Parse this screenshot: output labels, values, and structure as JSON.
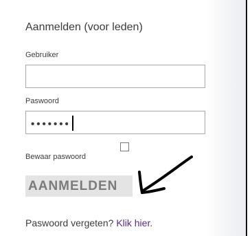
{
  "login": {
    "heading": "Aanmelden (voor leden)",
    "username_label": "Gebruiker",
    "username_value": "",
    "password_label": "Paswoord",
    "password_masked": "•••••••",
    "remember_label": "Bewaar paswoord",
    "remember_checked": false,
    "submit_label": "AANMELDEN",
    "forgot_text": "Paswoord vergeten? ",
    "forgot_link": "Klik hier."
  },
  "colors": {
    "text": "#3c3c3c",
    "link": "#5b2a86",
    "button_bg": "#e4e4e4",
    "button_text": "#7b7b7b",
    "field_border": "#a8a8a8"
  },
  "annotation": {
    "arrow_icon": "hand-drawn-arrow-icon"
  }
}
